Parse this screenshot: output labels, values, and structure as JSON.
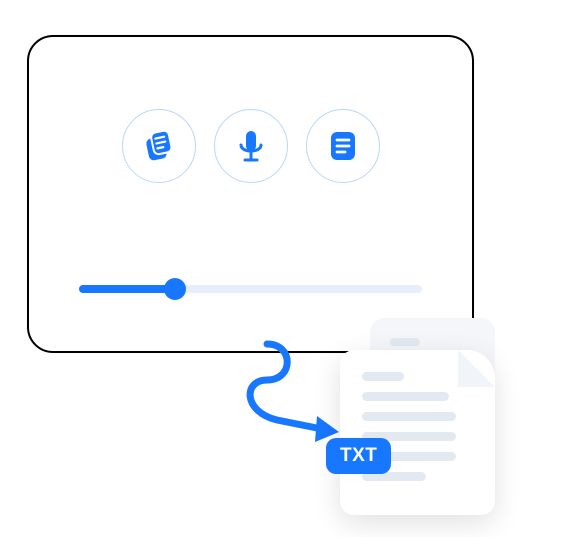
{
  "card": {
    "icons": {
      "copy": "copy-cards-icon",
      "mic": "microphone-icon",
      "note": "note-icon"
    },
    "slider": {
      "progress_percent": 28
    }
  },
  "file": {
    "badge_label": "TXT"
  },
  "colors": {
    "brand_blue": "#1877ff",
    "light_blue_border": "#b9d7f9",
    "track": "#e6eefc",
    "file_line": "#e3e9f1"
  }
}
